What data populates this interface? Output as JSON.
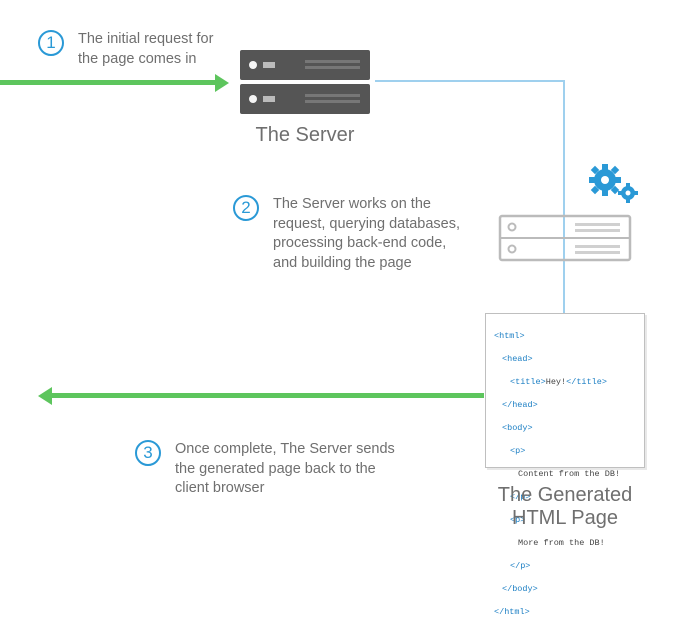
{
  "steps": [
    {
      "num": "1",
      "text": "The initial request for\nthe page comes in"
    },
    {
      "num": "2",
      "text": "The Server works on the\nrequest, querying databases,\nprocessing back-end code,\nand building the page"
    },
    {
      "num": "3",
      "text": "Once complete, The Server sends\nthe generated page back to the\nclient browser"
    }
  ],
  "captions": {
    "server": "The Server",
    "generated": "The Generated\nHTML Page"
  },
  "code": {
    "l1o": "<html>",
    "l1c": "</html>",
    "l2o": "<head>",
    "l2c": "</head>",
    "l3o": "<title>",
    "l3t": "Hey!",
    "l3c": "</title>",
    "l4o": "<body>",
    "l4c": "</body>",
    "l5o": "<p>",
    "l5c": "</p>",
    "l5t": "Content from the DB!",
    "l6t": "More from the DB!"
  }
}
